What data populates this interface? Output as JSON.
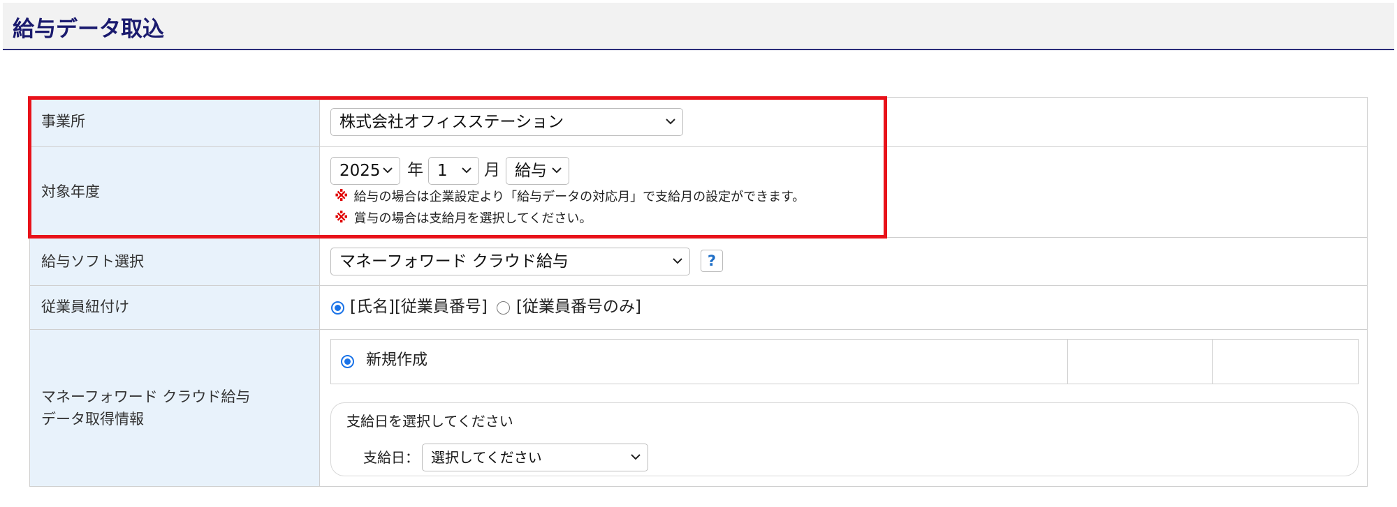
{
  "page": {
    "title": "給与データ取込"
  },
  "office": {
    "label": "事業所",
    "value": "株式会社オフィスステーション"
  },
  "target_period": {
    "label": "対象年度",
    "year": "2025",
    "year_unit": "年",
    "month": "1",
    "month_unit": "月",
    "type": "給与",
    "note_mark": "※",
    "note1": "給与の場合は企業設定より「給与データの対応月」で支給月の設定ができます。",
    "note2": "賞与の場合は支給月を選択してください。"
  },
  "software": {
    "label": "給与ソフト選択",
    "value": "マネーフォワード クラウド給与",
    "help": "?"
  },
  "employee_link": {
    "label": "従業員紐付け",
    "option1": "[氏名][従業員番号]",
    "option2": "[従業員番号のみ]",
    "selected": "option1"
  },
  "fetch_info": {
    "label_line1": "マネーフォワード クラウド給与",
    "label_line2": "データ取得情報",
    "new_create": "新規作成",
    "payday_prompt": "支給日を選択してください",
    "payday_label": "支給日：",
    "payday_value": "選択してください"
  },
  "colors": {
    "highlight": "#e8121a",
    "title": "#1a1a6e",
    "label_bg": "#e8f2fb",
    "radio": "#1a73e8"
  }
}
